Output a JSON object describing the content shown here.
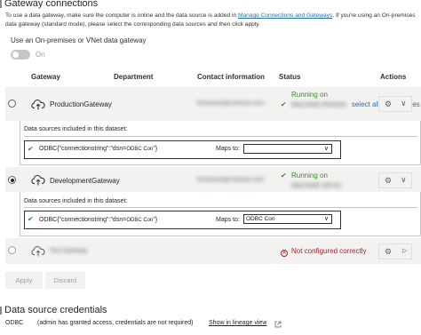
{
  "gateway_section": {
    "title": "Gateway connections",
    "intro_text": "To use a data gateway, make sure the computer is online and the data source is added in ",
    "intro_link": "Manage Connections and Gateways",
    "intro_text_2": ". If you're using an On-premises data gateway (standard mode), please select the corresponding data sources and then click apply.",
    "toggle_label": "Use an On-premises or VNet data gateway",
    "toggle_state": "On"
  },
  "table": {
    "headers": {
      "gateway": "Gateway",
      "department": "Department",
      "contact": "Contact information",
      "status": "Status",
      "actions": "Actions"
    }
  },
  "gateways": [
    {
      "name": "ProductionGateway",
      "contact": "firstname@contoso.com",
      "status_prefix": "Running on",
      "status_machine": "MACHINE-PROD01",
      "status_link": "select all datasources to use",
      "selected": false
    },
    {
      "name": "DevelopmentGateway",
      "contact": "firstname@contoso.com",
      "status_prefix": "Running on",
      "status_machine": "MACHINE-DEV01",
      "selected": true
    },
    {
      "name": "Test Gateway",
      "status": "Not configured correctly",
      "selected": false
    }
  ],
  "datasource_panels": [
    {
      "title": "Data sources included in this dataset:",
      "source": "ODBC{\"connectionstring\":\"dsn=",
      "source_highlight": "ODBC Con",
      "source_suffix": "\"}",
      "maps_to_label": "Maps to:",
      "maps_to_value": ""
    },
    {
      "title": "Data sources included in this dataset:",
      "source": "ODBC{\"connectionstring\":\"dsn=",
      "source_highlight": "ODBC Con",
      "source_suffix": "\"}",
      "maps_to_label": "Maps to:",
      "maps_to_value": "ODBC Con"
    }
  ],
  "buttons": {
    "apply": "Apply",
    "discard": "Discard"
  },
  "credentials": {
    "title": "Data source credentials",
    "source": "ODBC",
    "note": "(admin has granted access, credentials are not required)",
    "lineage_link": "Show in lineage view"
  },
  "icons": {
    "gateway": "cloud-upload-icon",
    "check": "check-circle-icon",
    "error": "error-circle-icon",
    "settings": "gear-icon",
    "expand": "chevron-icon",
    "external": "external-link-icon"
  },
  "colors": {
    "status_ok": "#3a8a2e",
    "status_error": "#a4262c",
    "link": "#1f6fb5",
    "row_bg": "#f3f2f1"
  }
}
